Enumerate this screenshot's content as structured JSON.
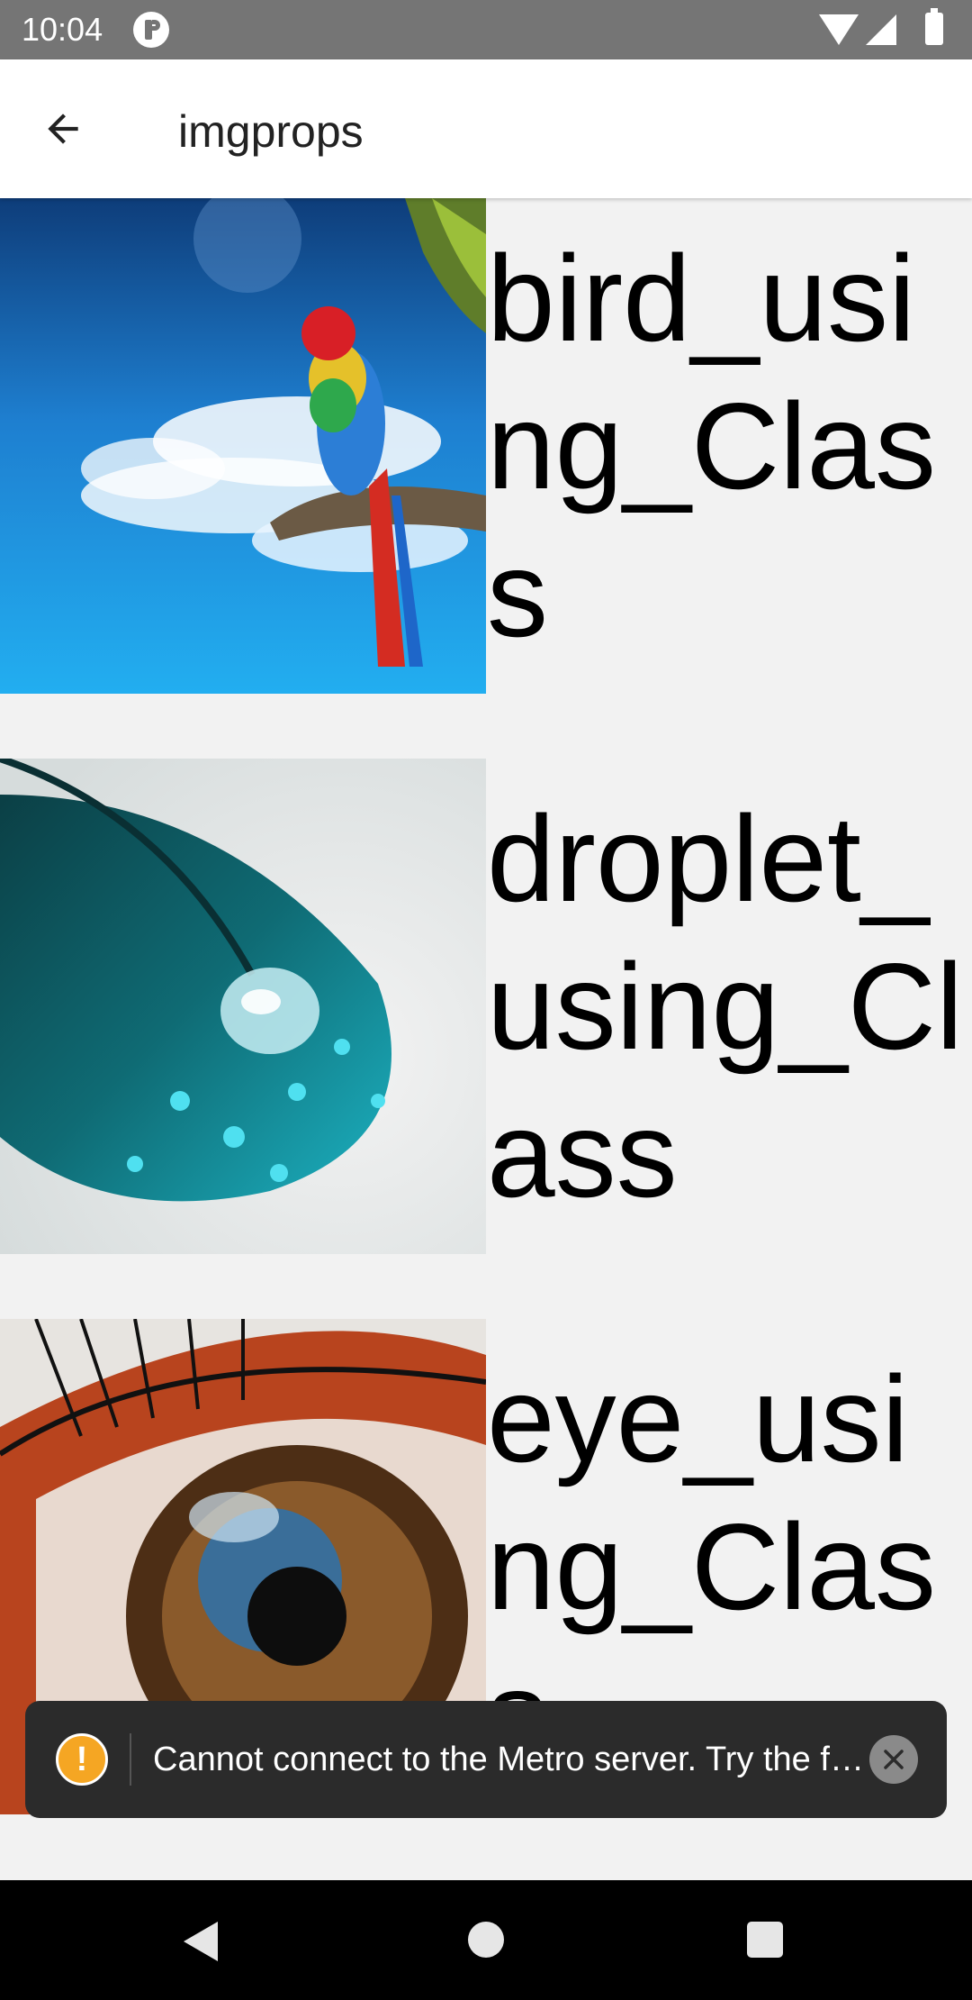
{
  "status_bar": {
    "time": "10:04"
  },
  "app_bar": {
    "title": "imgprops"
  },
  "list": {
    "items": [
      {
        "label": " bird_using_Class",
        "image": "parrot"
      },
      {
        "label": " droplet_using_Class",
        "image": "feather-droplet"
      },
      {
        "label": "eye_using_Class",
        "image": "eye"
      }
    ]
  },
  "toast": {
    "message": "Cannot connect to the Metro server.  Try the following to fix the issue:"
  },
  "colors": {
    "status_bar": "#757575",
    "toast_bg": "#2b2b2b",
    "warning": "#f5a623",
    "nav_bar": "#000000"
  }
}
